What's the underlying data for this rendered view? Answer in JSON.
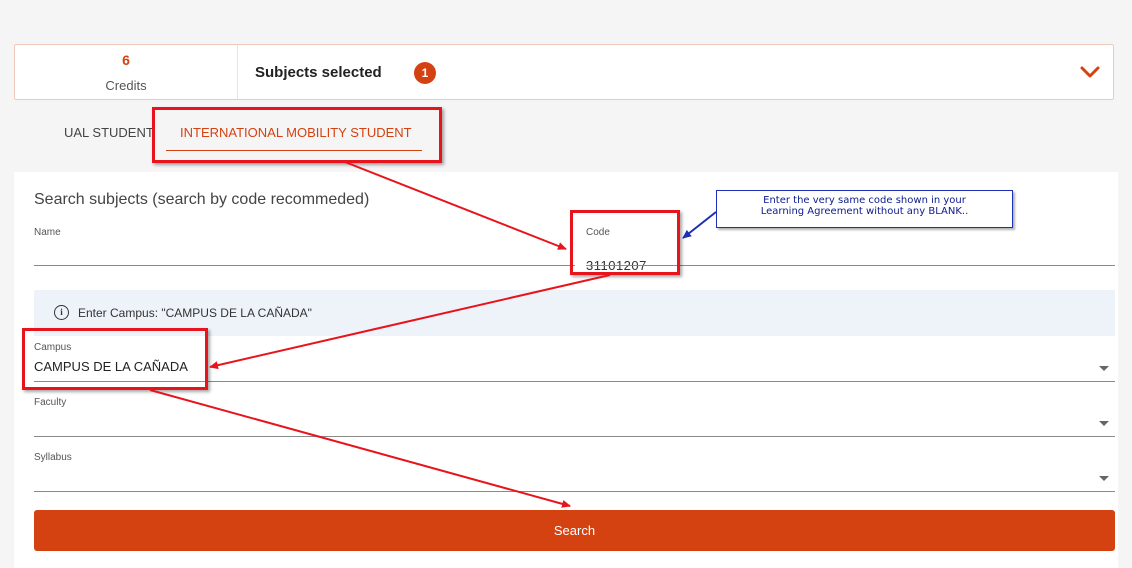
{
  "summary": {
    "credits_value": "6",
    "credits_label": "Credits",
    "selected_label": "Subjects selected",
    "selected_count": "1",
    "expand_icon": "chevron-down-icon"
  },
  "tabs": [
    {
      "label": "UAL STUDENT",
      "active": false
    },
    {
      "label": "INTERNATIONAL MOBILITY STUDENT",
      "active": true
    }
  ],
  "search_form": {
    "title": "Search subjects (search by code recommeded)",
    "name_label": "Name",
    "name_value": "",
    "code_label": "Code",
    "code_value": "31101207",
    "info_icon": "info-circle-icon",
    "info_text": "Enter Campus: \"CAMPUS DE LA CAÑADA\"",
    "campus_label": "Campus",
    "campus_value": "CAMPUS DE LA CAÑADA",
    "faculty_label": "Faculty",
    "faculty_value": "",
    "syllabus_label": "Syllabus",
    "syllabus_value": "",
    "search_button": "Search"
  },
  "annotation": {
    "callout_line1": "Enter the very same code shown in your",
    "callout_line2": "Learning Agreement without any BLANK.."
  },
  "colors": {
    "accent": "#d44212",
    "annotation_red": "#e8141c",
    "annotation_blue": "#1e2fb5",
    "info_background": "#eef3fa"
  }
}
